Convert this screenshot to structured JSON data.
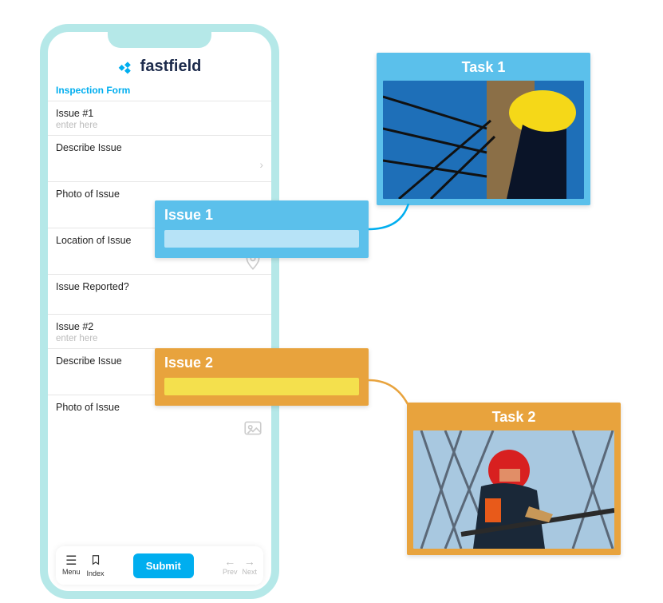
{
  "app": {
    "name": "fastfield",
    "form_title": "Inspection Form"
  },
  "form": {
    "issue1": {
      "label": "Issue #1",
      "placeholder": "enter here",
      "describe_label": "Describe Issue",
      "photo_label": "Photo of Issue",
      "location_label": "Location of Issue",
      "reported_label": "Issue Reported?"
    },
    "issue2": {
      "label": "Issue #2",
      "placeholder": "enter here",
      "describe_label": "Describe Issue",
      "photo_label": "Photo of Issue"
    }
  },
  "navbar": {
    "menu": "Menu",
    "index": "Index",
    "submit": "Submit",
    "prev": "Prev",
    "next": "Next"
  },
  "overlays": {
    "issue1_title": "Issue 1",
    "issue2_title": "Issue 2",
    "task1_title": "Task 1",
    "task2_title": "Task 2"
  }
}
